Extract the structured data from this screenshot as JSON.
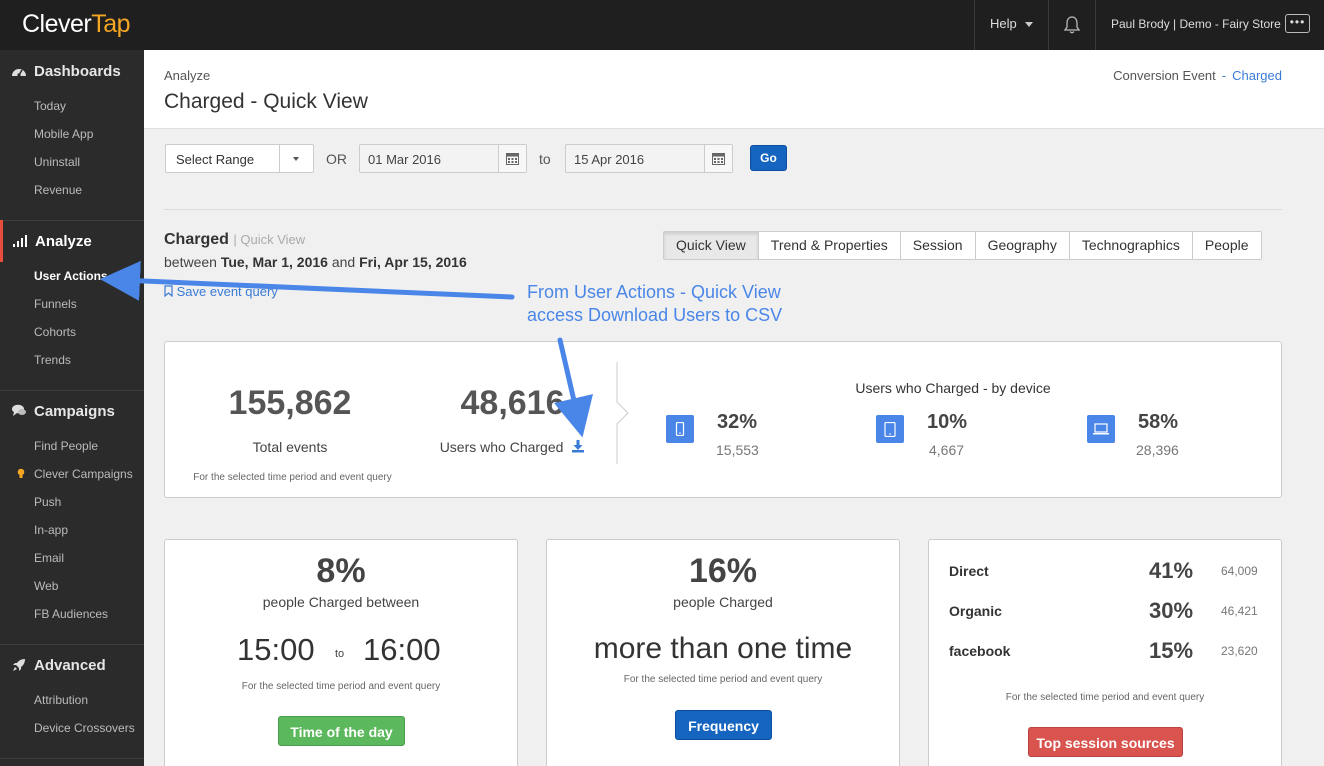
{
  "topbar": {
    "logo_part1": "Clever",
    "logo_part2": "Tap",
    "help_label": "Help",
    "account_label": "Paul Brody | Demo - Fairy Store",
    "more_label": "•••"
  },
  "sidebar": {
    "sections": [
      {
        "label": "Dashboards",
        "icon": "dashboard-icon",
        "items": [
          "Today",
          "Mobile App",
          "Uninstall",
          "Revenue"
        ]
      },
      {
        "label": "Analyze",
        "icon": "bar-chart-icon",
        "items": [
          "User Actions",
          "Funnels",
          "Cohorts",
          "Trends"
        ]
      },
      {
        "label": "Campaigns",
        "icon": "chat-icon",
        "items": [
          "Find People",
          "Clever Campaigns",
          "Push",
          "In-app",
          "Email",
          "Web",
          "FB Audiences"
        ]
      },
      {
        "label": "Advanced",
        "icon": "rocket-icon",
        "items": [
          "Attribution",
          "Device Crossovers"
        ]
      }
    ],
    "active_item": "User Actions"
  },
  "header": {
    "breadcrumb": "Analyze",
    "title": "Charged - Quick View",
    "conversion_label": "Conversion Event",
    "conversion_sep": "-",
    "conversion_value": "Charged"
  },
  "filters": {
    "range_select": "Select Range",
    "or_label": "OR",
    "from_date": "01 Mar 2016",
    "to_label": "to",
    "to_date": "15 Apr 2016",
    "go_label": "Go"
  },
  "summary": {
    "event_name": "Charged",
    "view_name": "| Quick View",
    "between_prefix": "between",
    "start_date": "Tue, Mar 1, 2016",
    "and_label": "and",
    "end_date": "Fri, Apr 15, 2016",
    "save_query": "Save event query"
  },
  "tabs": [
    "Quick View",
    "Trend & Properties",
    "Session",
    "Geography",
    "Technographics",
    "People"
  ],
  "annotation": {
    "line1": "From User Actions - Quick View",
    "line2": "access Download Users to CSV"
  },
  "stats": {
    "total_events_value": "155,862",
    "total_events_label": "Total events",
    "users_value": "48,616",
    "users_label": "Users who Charged",
    "footnote": "For the selected time period and event query",
    "device_title": "Users who Charged - by device",
    "devices": [
      {
        "icon": "mobile-icon",
        "pct": "32%",
        "count": "15,553"
      },
      {
        "icon": "tablet-icon",
        "pct": "10%",
        "count": "4,667"
      },
      {
        "icon": "desktop-icon",
        "pct": "58%",
        "count": "28,396"
      }
    ]
  },
  "time_card": {
    "pct": "8%",
    "sub": "people Charged between",
    "from": "15:00",
    "to_label": "to",
    "to": "16:00",
    "footnote": "For the selected time period and event query",
    "button": "Time of the day"
  },
  "freq_card": {
    "pct": "16%",
    "sub": "people Charged",
    "headline": "more than one time",
    "footnote": "For the selected time period and event query",
    "button": "Frequency"
  },
  "source_card": {
    "sources": [
      {
        "name": "Direct",
        "pct": "41%",
        "count": "64,009"
      },
      {
        "name": "Organic",
        "pct": "30%",
        "count": "46,421"
      },
      {
        "name": "facebook",
        "pct": "15%",
        "count": "23,620"
      }
    ],
    "footnote": "For the selected time period and event query",
    "button": "Top session sources"
  },
  "colors": {
    "accent_blue": "#4a86e8",
    "go_blue": "#1565c0",
    "green": "#5cb85c",
    "red": "#d9534f",
    "logo_orange": "#f5a623"
  }
}
